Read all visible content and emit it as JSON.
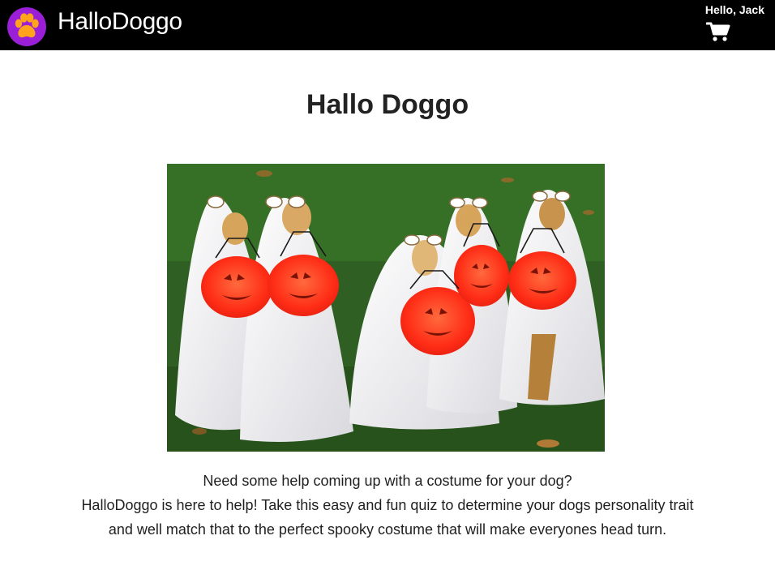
{
  "navbar": {
    "brand": "HalloDoggo",
    "greeting": "Hello, Jack",
    "logo_icon": "paw-icon",
    "cart_icon": "shopping-cart-icon"
  },
  "main": {
    "title": "Hallo Doggo",
    "hero_image": "five dogs in white sheet ghost costumes holding orange pumpkin buckets on grass",
    "intro": [
      "Need some help coming up with a costume for your dog?",
      "HalloDoggo is here to help! Take this easy and fun quiz to determine your dogs personality trait and well match that to the perfect spooky costume that will make everyones head turn."
    ]
  },
  "colors": {
    "navbar_bg": "#000000",
    "logo_bg": "#9b1fd6",
    "paw": "#ffa41b",
    "grass": "#2f5f22",
    "pumpkin": "#ff3a1f"
  }
}
